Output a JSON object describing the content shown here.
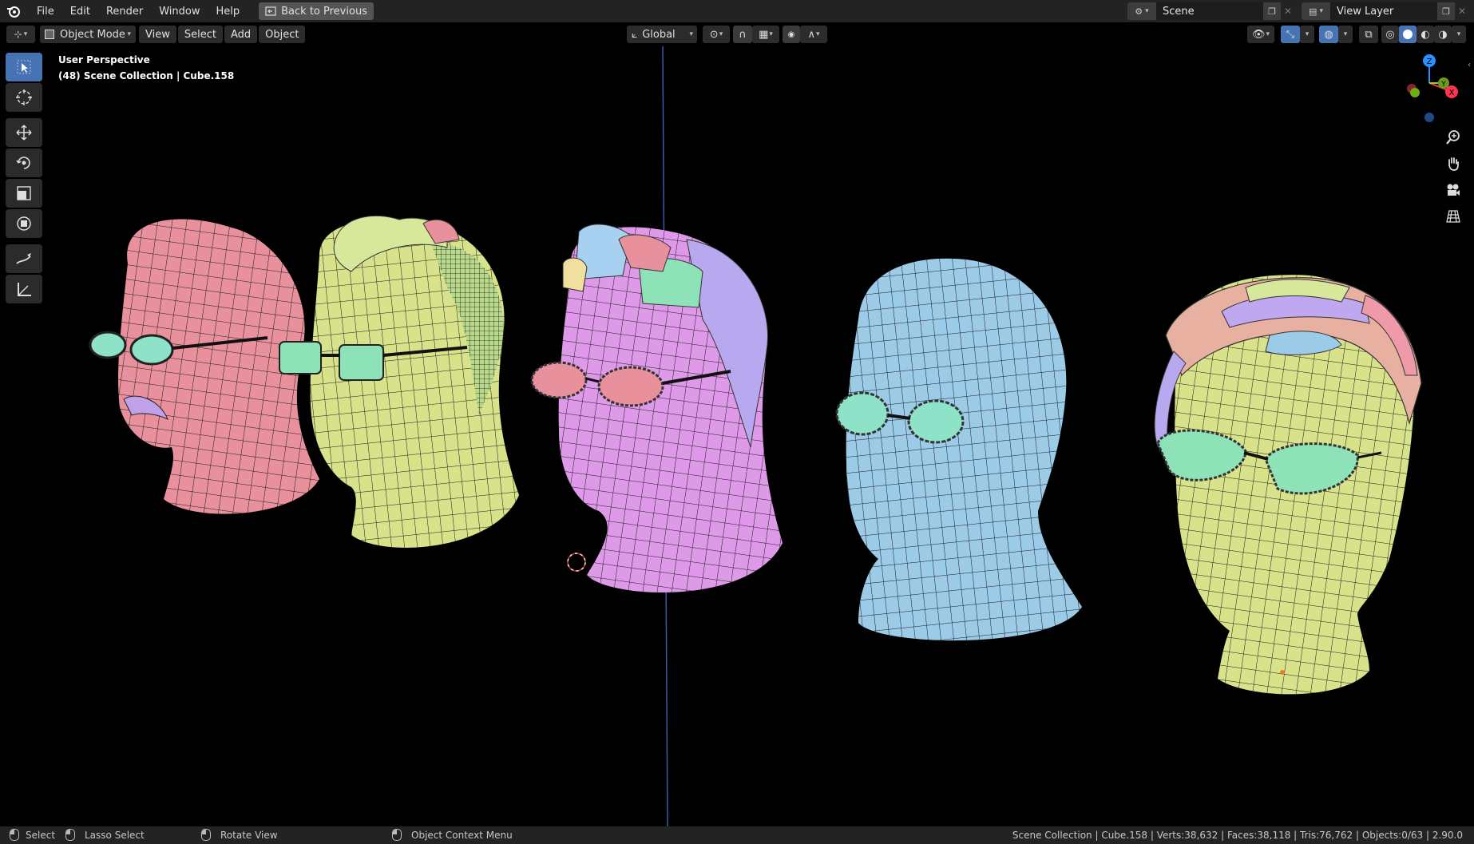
{
  "topbar": {
    "menus": [
      "File",
      "Edit",
      "Render",
      "Window",
      "Help"
    ],
    "back_button": "Back to Previous",
    "scene": {
      "value": "Scene"
    },
    "view_layer": {
      "value": "View Layer"
    }
  },
  "viewport_header": {
    "mode": "Object Mode",
    "menus": [
      "View",
      "Select",
      "Add",
      "Object"
    ],
    "orientation": "Global"
  },
  "overlay": {
    "perspective": "User Perspective",
    "collection": "(48) Scene Collection | Cube.158"
  },
  "toolbar": {
    "tools": [
      "select-box",
      "cursor",
      "move",
      "rotate",
      "scale",
      "transform",
      "annotate",
      "measure"
    ],
    "active": "select-box"
  },
  "navigation": {
    "gizmo_axes": [
      "Z",
      "Y",
      "X"
    ],
    "axis_colors": {
      "x": "#ff3352",
      "y": "#8bdc00",
      "z": "#2890ff"
    }
  },
  "statusbar": {
    "select": "Select",
    "lasso": "Lasso Select",
    "rotate": "Rotate View",
    "context": "Object Context Menu",
    "stats": "Scene Collection | Cube.158 | Verts:38,632 | Faces:38,118 | Tris:76,762 | Objects:0/63 | 2.90.0"
  },
  "colors": {
    "pink": "#e8909c",
    "yellow": "#d8e28a",
    "magenta": "#de9ae8",
    "blue": "#9ccbe8",
    "green": "#8ee2b8",
    "accent": "#4772b3"
  }
}
